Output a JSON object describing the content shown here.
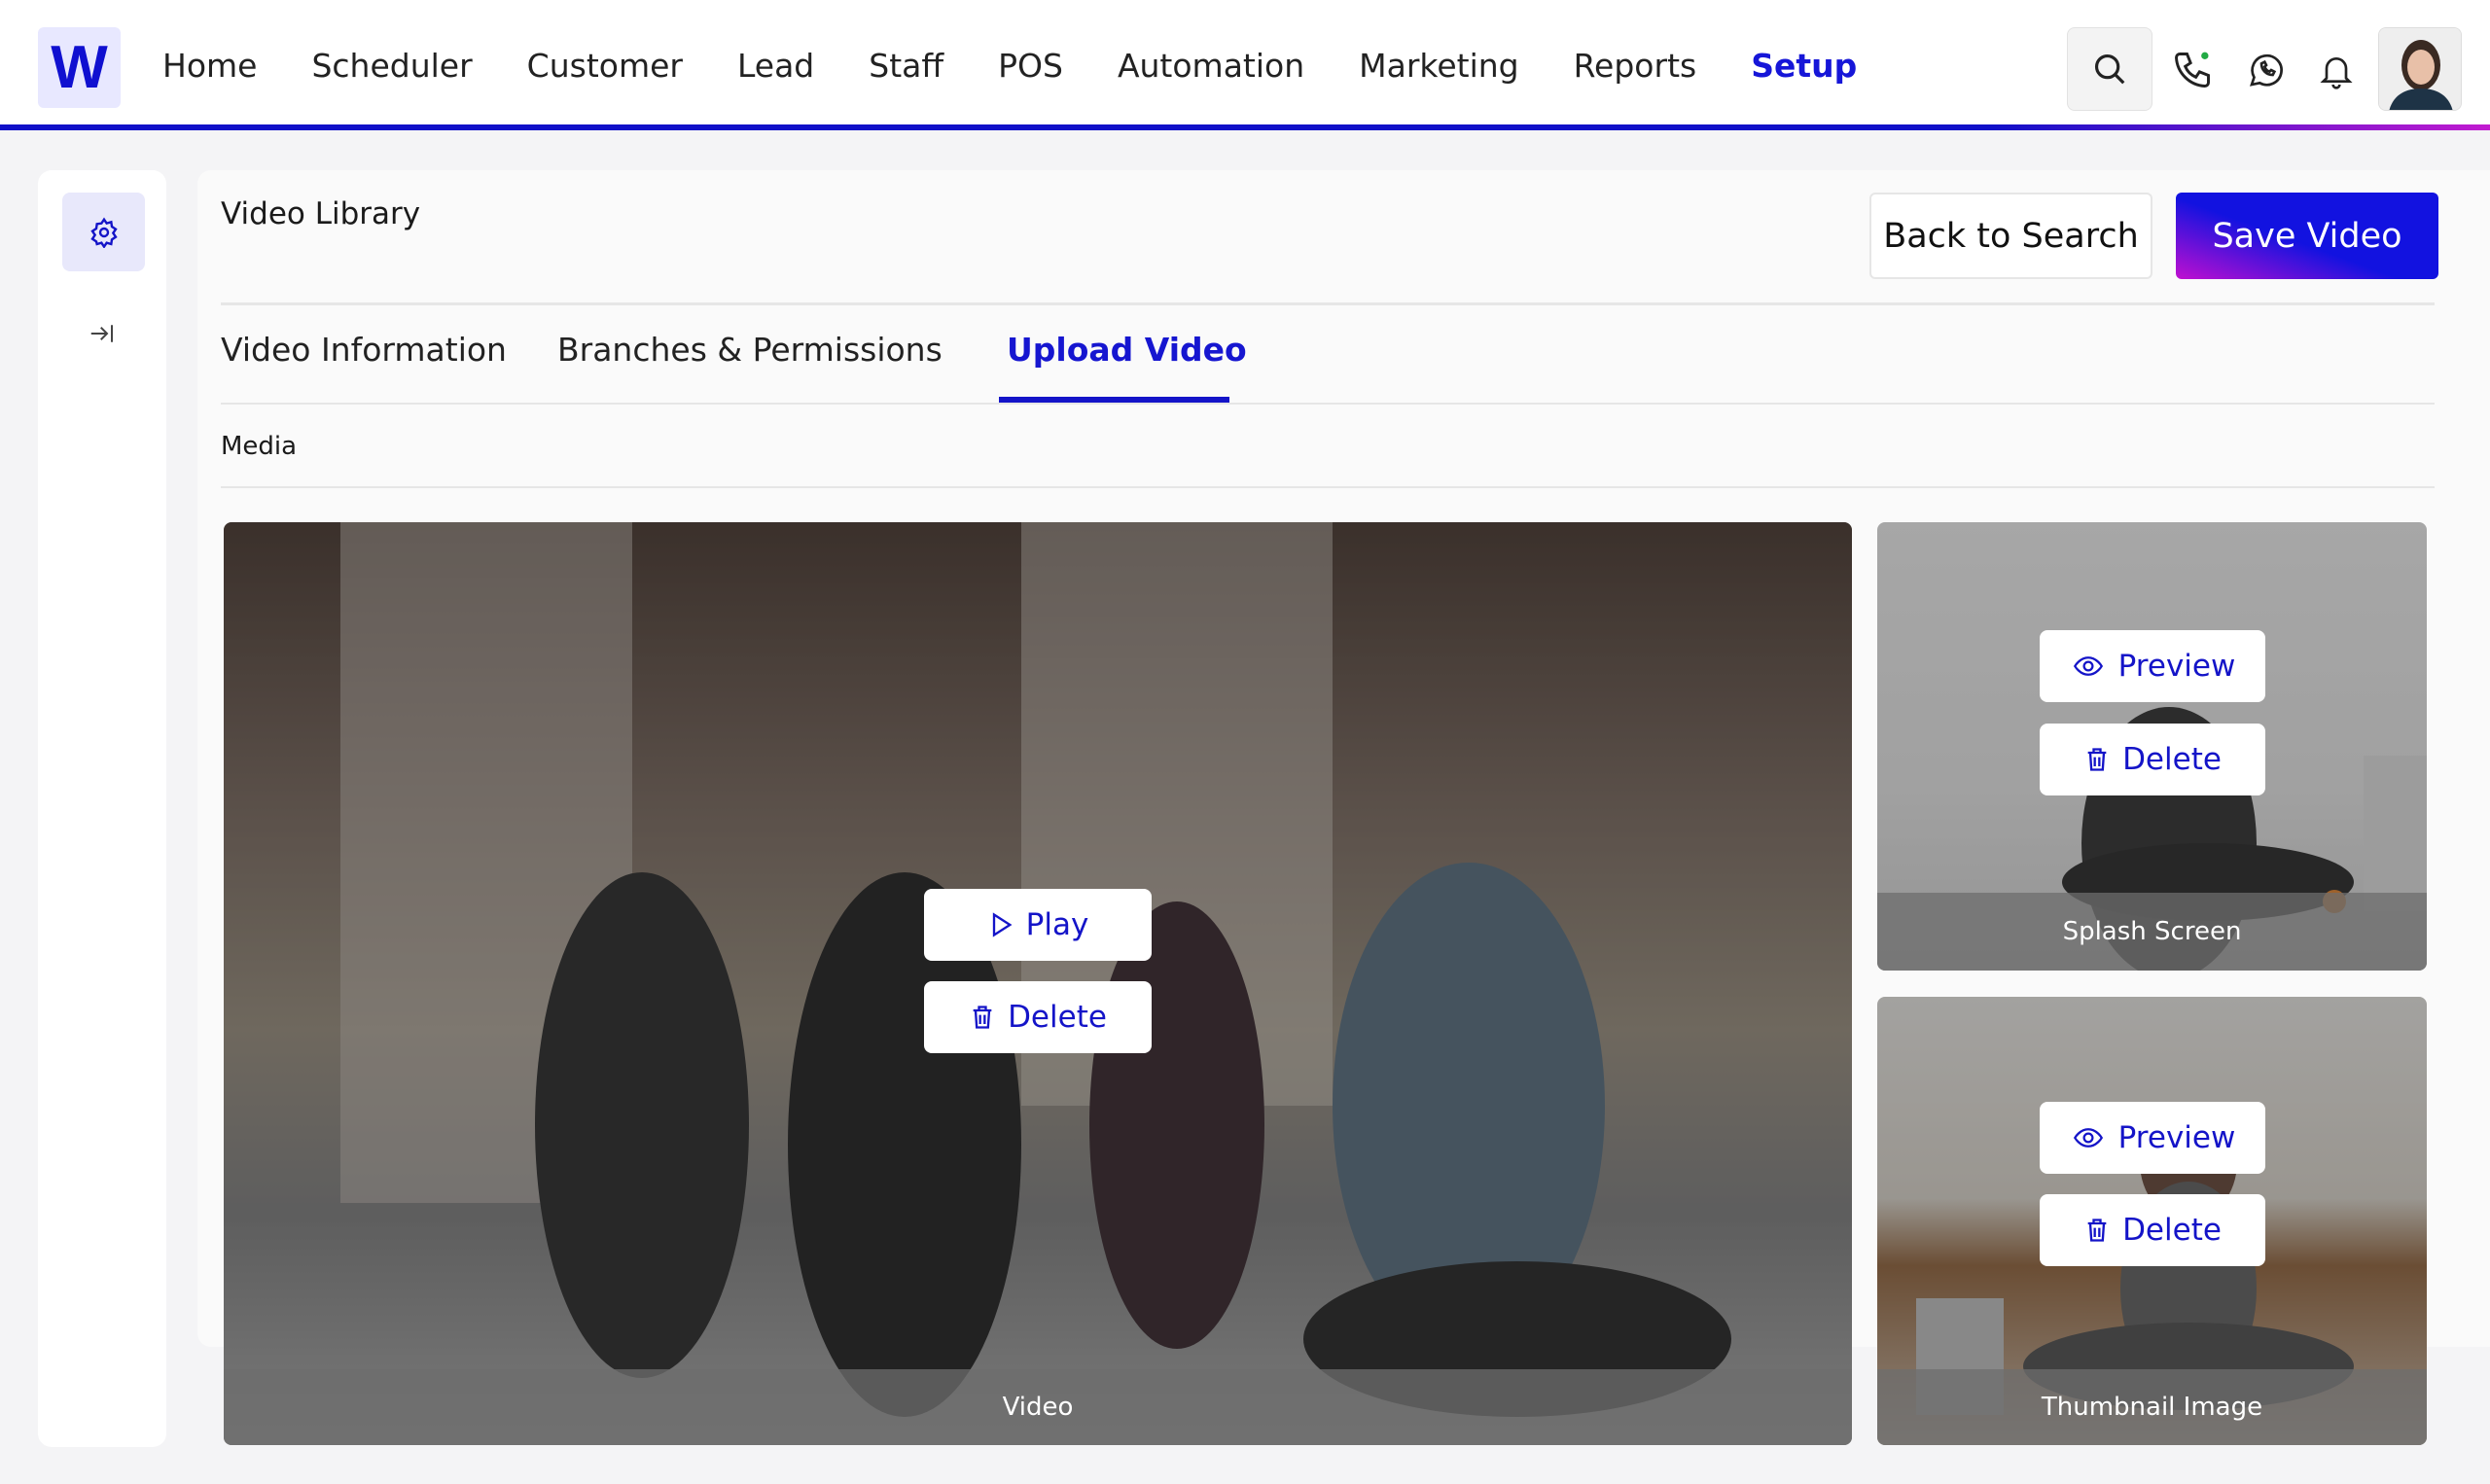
{
  "header": {
    "logo": "W",
    "nav": [
      "Home",
      "Scheduler",
      "Customer",
      "Lead",
      "Staff",
      "POS",
      "Automation",
      "Marketing",
      "Reports",
      "Setup"
    ],
    "active_nav": "Setup",
    "icons": [
      "search-icon",
      "phone-icon",
      "whatsapp-icon",
      "bell-icon",
      "avatar"
    ]
  },
  "colors": {
    "accent": "#1414c8",
    "gradient_end": "#c010d0"
  },
  "page": {
    "title": "Video Library",
    "back_label": "Back to Search",
    "save_label": "Save Video",
    "tabs": [
      "Video Information",
      "Branches & Permissions",
      "Upload Video"
    ],
    "active_tab": "Upload Video",
    "section": "Media"
  },
  "media": {
    "video": {
      "caption": "Video",
      "play": "Play",
      "delete": "Delete"
    },
    "splash": {
      "caption": "Splash Screen",
      "preview": "Preview",
      "delete": "Delete"
    },
    "thumbnail": {
      "caption": "Thumbnail Image",
      "preview": "Preview",
      "delete": "Delete"
    }
  }
}
